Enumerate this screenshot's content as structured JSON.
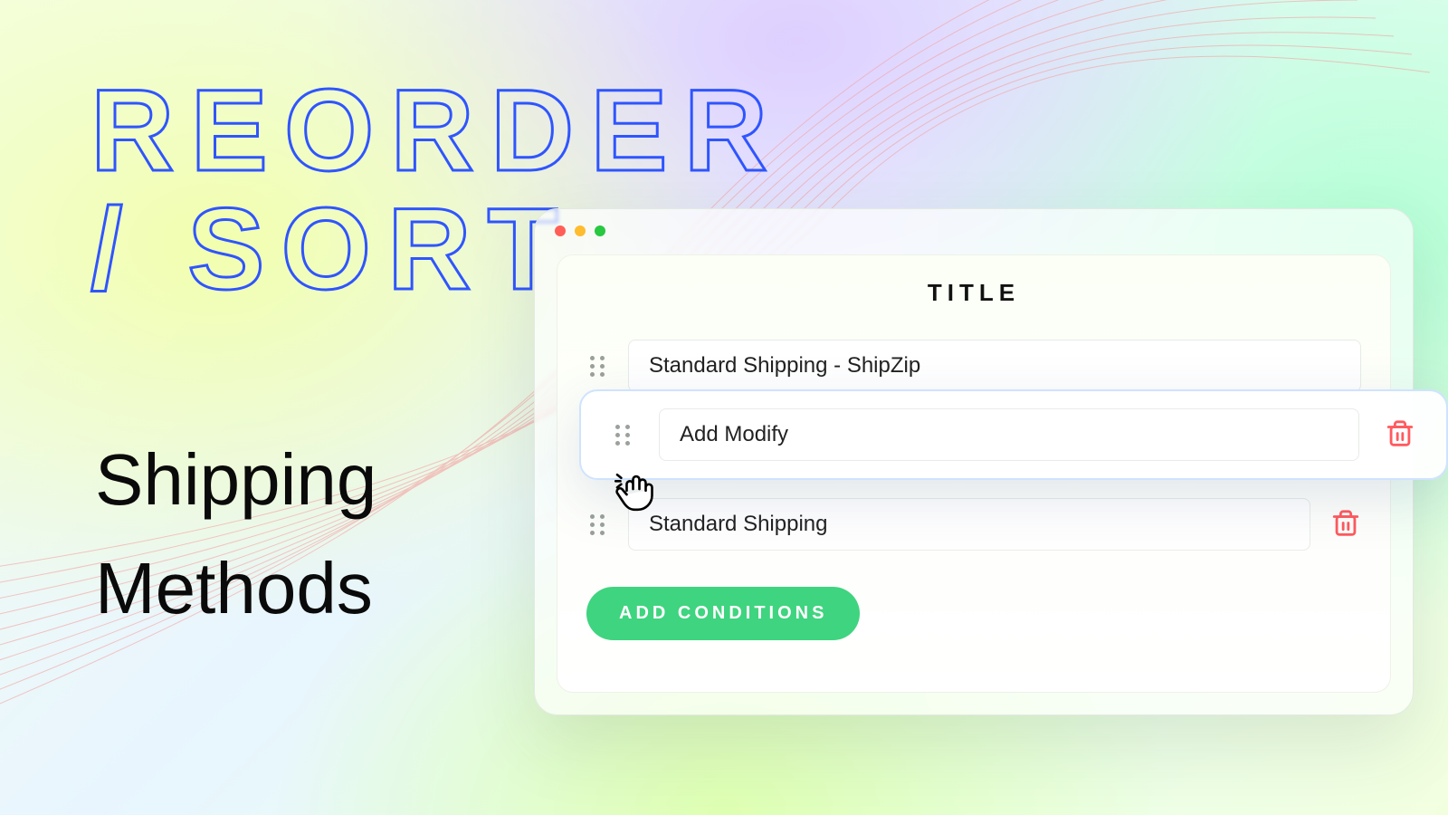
{
  "headline": "REORDER / SORT",
  "subhead": "Shipping Methods",
  "panel": {
    "title": "TITLE",
    "rows": [
      {
        "value": "Standard Shipping - ShipZip",
        "show_trash": false
      },
      {
        "value": "Standard Shipping",
        "show_trash": true
      }
    ]
  },
  "floating_row": {
    "value": "Add Modify"
  },
  "add_button": "ADD CONDITIONS",
  "colors": {
    "accent_blue": "#2f55ff",
    "button_green": "#3fd47f",
    "danger": "#ff5a5f"
  }
}
